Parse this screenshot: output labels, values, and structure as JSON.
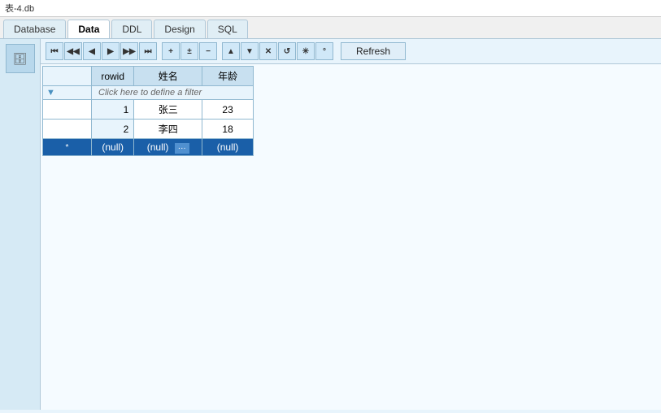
{
  "titleBar": {
    "text": "表-4.db"
  },
  "tabs": [
    {
      "label": "Database",
      "active": false
    },
    {
      "label": "Data",
      "active": true
    },
    {
      "label": "DDL",
      "active": false
    },
    {
      "label": "Design",
      "active": false
    },
    {
      "label": "SQL",
      "active": false
    }
  ],
  "toolbar": {
    "buttons": [
      {
        "symbol": "⏮",
        "name": "first"
      },
      {
        "symbol": "◀◀",
        "name": "prev-many"
      },
      {
        "symbol": "◀",
        "name": "prev"
      },
      {
        "symbol": "▶",
        "name": "next"
      },
      {
        "symbol": "▶▶",
        "name": "next-many"
      },
      {
        "symbol": "⏭",
        "name": "last"
      },
      {
        "symbol": "+",
        "name": "add"
      },
      {
        "symbol": "±",
        "name": "edit"
      },
      {
        "symbol": "−",
        "name": "delete"
      },
      {
        "symbol": "▲",
        "name": "up"
      },
      {
        "symbol": "▼",
        "name": "down"
      },
      {
        "symbol": "✕",
        "name": "cancel"
      },
      {
        "symbol": "↺",
        "name": "refresh-small"
      },
      {
        "symbol": "*",
        "name": "asterisk1"
      },
      {
        "symbol": "°",
        "name": "asterisk2"
      }
    ],
    "refreshLabel": "Refresh"
  },
  "table": {
    "columns": [
      {
        "key": "rowid",
        "label": "rowid"
      },
      {
        "key": "name",
        "label": "姓名"
      },
      {
        "key": "age",
        "label": "年龄"
      }
    ],
    "filterPlaceholder": "Click here to define a filter",
    "rows": [
      {
        "rowid": "1",
        "name": "张三",
        "age": "23"
      },
      {
        "rowid": "2",
        "name": "李四",
        "age": "18"
      }
    ],
    "newRow": {
      "rowid": "(null)",
      "name": "(null)",
      "age": "(null)"
    }
  }
}
